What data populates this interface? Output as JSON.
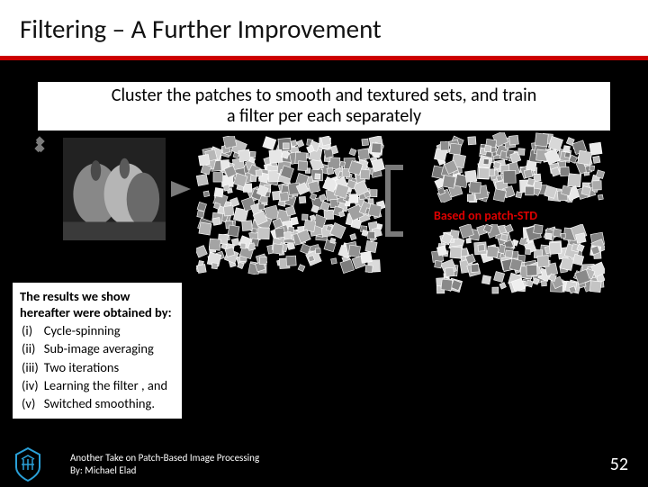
{
  "title": "Filtering – A Further Improvement",
  "subtitle_line1": "Cluster the patches to smooth and textured sets, and train",
  "subtitle_line2": "a filter per each separately",
  "std_label": "Based on patch-STD",
  "results": {
    "heading1": "The results we show",
    "heading2": "hereafter were obtained by:",
    "items": [
      {
        "n": "(i)",
        "t": "Cycle-spinning"
      },
      {
        "n": "(ii)",
        "t": "Sub-image averaging"
      },
      {
        "n": "(iii)",
        "t": "Two iterations"
      },
      {
        "n": "(iv)",
        "t": "Learning the filter , and"
      },
      {
        "n": "(v)",
        "t": "Switched  smoothing."
      }
    ]
  },
  "footer": {
    "line1": "Another Take on Patch-Based Image Processing",
    "line2": "By: Michael Elad",
    "page": "52"
  }
}
